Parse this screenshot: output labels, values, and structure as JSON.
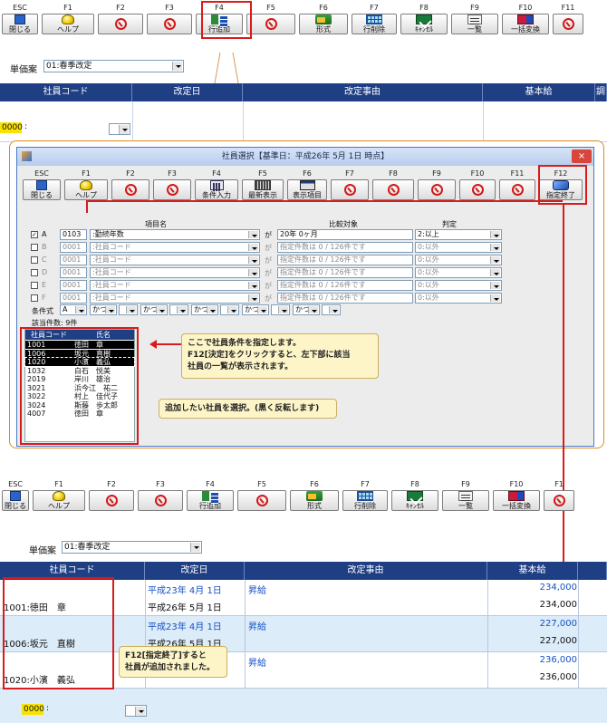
{
  "top_toolbar": {
    "keys": [
      {
        "key": "ESC",
        "label": "閉じる",
        "icon": "door-icon"
      },
      {
        "key": "F1",
        "label": "ヘルプ",
        "icon": "help-bulb-icon"
      },
      {
        "key": "F2",
        "label": "",
        "icon": "disabled-icon"
      },
      {
        "key": "F3",
        "label": "",
        "icon": "disabled-icon"
      },
      {
        "key": "F4",
        "label": "行追加",
        "icon": "add-row-icon"
      },
      {
        "key": "F5",
        "label": "",
        "icon": "disabled-icon"
      },
      {
        "key": "F6",
        "label": "形式",
        "icon": "format-icon"
      },
      {
        "key": "F7",
        "label": "行削除",
        "icon": "delete-row-icon"
      },
      {
        "key": "F8",
        "label": "ｷｬﾝｾﾙ",
        "icon": "cancel-icon"
      },
      {
        "key": "F9",
        "label": "一覧",
        "icon": "list-icon"
      },
      {
        "key": "F10",
        "label": "一括変換",
        "icon": "bulk-convert-icon"
      },
      {
        "key": "F11",
        "label": "",
        "icon": "disabled-icon"
      }
    ]
  },
  "top_form": {
    "plan_label": "単価案",
    "plan_value": "01:春季改定"
  },
  "top_grid": {
    "headers": [
      "社員コード",
      "改定日",
      "改定事由",
      "基本給",
      "調"
    ],
    "code_input": "0000"
  },
  "dialog": {
    "title": "社員選択【基準日：平成26年 5月 1日 時点】",
    "close": "×",
    "toolbar": [
      {
        "key": "ESC",
        "label": "閉じる",
        "icon": "door-icon"
      },
      {
        "key": "F1",
        "label": "ヘルプ",
        "icon": "help-bulb-icon"
      },
      {
        "key": "F2",
        "label": "",
        "icon": "disabled-icon"
      },
      {
        "key": "F3",
        "label": "",
        "icon": "disabled-icon"
      },
      {
        "key": "F4",
        "label": "条件入力",
        "icon": "calculator-icon"
      },
      {
        "key": "F5",
        "label": "最新表示",
        "icon": "keyboard-icon"
      },
      {
        "key": "F6",
        "label": "表示項目",
        "icon": "screen-icon"
      },
      {
        "key": "F7",
        "label": "",
        "icon": "disabled-icon"
      },
      {
        "key": "F8",
        "label": "",
        "icon": "disabled-icon"
      },
      {
        "key": "F9",
        "label": "",
        "icon": "disabled-icon"
      },
      {
        "key": "F10",
        "label": "",
        "icon": "disabled-icon"
      },
      {
        "key": "F11",
        "label": "",
        "icon": "disabled-icon"
      },
      {
        "key": "F12",
        "label": "指定終了",
        "icon": "done-icon"
      }
    ],
    "criteria_headers": {
      "item": "項目名",
      "compare": "比較対象",
      "judge": "判定"
    },
    "criteria": [
      {
        "letter": "A",
        "checked": "✓",
        "code": "0103",
        "item": ":勤続年数",
        "ga": "が",
        "compare": "20年 0ヶ月",
        "judge": "2:以上",
        "active": true
      },
      {
        "letter": "B",
        "checked": "",
        "code": "0001",
        "item": ":社員コード",
        "ga": "が",
        "compare": "指定件数は 0 / 126件です",
        "judge": "0:以外",
        "active": false
      },
      {
        "letter": "C",
        "checked": "",
        "code": "0001",
        "item": ":社員コード",
        "ga": "が",
        "compare": "指定件数は 0 / 126件です",
        "judge": "0:以外",
        "active": false
      },
      {
        "letter": "D",
        "checked": "",
        "code": "0001",
        "item": ":社員コード",
        "ga": "が",
        "compare": "指定件数は 0 / 126件です",
        "judge": "0:以外",
        "active": false
      },
      {
        "letter": "E",
        "checked": "",
        "code": "0001",
        "item": ":社員コード",
        "ga": "が",
        "compare": "指定件数は 0 / 126件です",
        "judge": "0:以外",
        "active": false
      },
      {
        "letter": "F",
        "checked": "",
        "code": "0001",
        "item": ":社員コード",
        "ga": "が",
        "compare": "指定件数は 0 / 126件です",
        "judge": "0:以外",
        "active": false
      }
    ],
    "condition_label": "条件式",
    "condition_first": "A",
    "condition_ops": [
      "かつ",
      "かつ",
      "かつ",
      "かつ",
      "かつ"
    ],
    "result_count": "該当件数: 9件",
    "employee_list": {
      "headers": [
        "社員コード",
        "氏名"
      ],
      "rows": [
        {
          "code": "1001",
          "name": "徳田　章",
          "state": "selected"
        },
        {
          "code": "1006",
          "name": "坂元　直樹",
          "state": "selected"
        },
        {
          "code": "1020",
          "name": "小濱　義弘",
          "state": "focused"
        },
        {
          "code": "1032",
          "name": "白石　悦美",
          "state": ""
        },
        {
          "code": "2019",
          "name": "岸川　雄治",
          "state": ""
        },
        {
          "code": "3021",
          "name": "浜今江　祐二",
          "state": ""
        },
        {
          "code": "3022",
          "name": "村上　佳代子",
          "state": ""
        },
        {
          "code": "3024",
          "name": "斯藤　歩太郎",
          "state": ""
        },
        {
          "code": "4007",
          "name": "徳田　章",
          "state": ""
        }
      ]
    },
    "callout_condition": {
      "line1": "ここで社員条件を指定します。",
      "line2": "F12[決定]をクリックすると、左下部に該当",
      "line3": "社員の一覧が表示されます。"
    },
    "callout_select": "追加したい社員を選択。(黒く反転します)"
  },
  "bottom_toolbar": {
    "keys": [
      {
        "key": "ESC",
        "label": "閉じる",
        "icon": "door-icon"
      },
      {
        "key": "F1",
        "label": "ヘルプ",
        "icon": "help-bulb-icon"
      },
      {
        "key": "F2",
        "label": "",
        "icon": "disabled-icon"
      },
      {
        "key": "F3",
        "label": "",
        "icon": "disabled-icon"
      },
      {
        "key": "F4",
        "label": "行追加",
        "icon": "add-row-icon"
      },
      {
        "key": "F5",
        "label": "",
        "icon": "disabled-icon"
      },
      {
        "key": "F6",
        "label": "形式",
        "icon": "format-icon"
      },
      {
        "key": "F7",
        "label": "行削除",
        "icon": "delete-row-icon"
      },
      {
        "key": "F8",
        "label": "ｷｬﾝｾﾙ",
        "icon": "cancel-icon"
      },
      {
        "key": "F9",
        "label": "一覧",
        "icon": "list-icon"
      },
      {
        "key": "F10",
        "label": "一括変換",
        "icon": "bulk-convert-icon"
      },
      {
        "key": "F1",
        "label": "",
        "icon": "disabled-icon"
      }
    ]
  },
  "bottom_form": {
    "plan_label": "単価案",
    "plan_value": "01:春季改定"
  },
  "bottom_grid": {
    "headers": [
      "社員コード",
      "改定日",
      "改定事由",
      "基本給"
    ],
    "rows": [
      {
        "employee": "1001:徳田　章",
        "old_date": "平成23年 4月 1日",
        "reason": "昇給",
        "old_pay": "234,000",
        "new_date": "平成26年 5月 1日",
        "new_pay": "234,000"
      },
      {
        "employee": "1006:坂元　直樹",
        "old_date": "平成23年 4月 1日",
        "reason": "昇給",
        "old_pay": "227,000",
        "new_date": "平成26年 5月 1日",
        "new_pay": "227,000"
      },
      {
        "employee": "1020:小濱　義弘",
        "old_date": "",
        "reason": "昇給",
        "old_pay": "236,000",
        "new_date": "",
        "new_pay": "236,000"
      }
    ],
    "code_input": "0000",
    "callout": {
      "line1": "F12[指定終了]すると",
      "line2": "社員が追加されました。"
    }
  },
  "colors": {
    "header": "#1f3f85",
    "accent_red": "#d81b1b",
    "link_blue": "#1451c8",
    "row_tint": "#dcecf8"
  }
}
